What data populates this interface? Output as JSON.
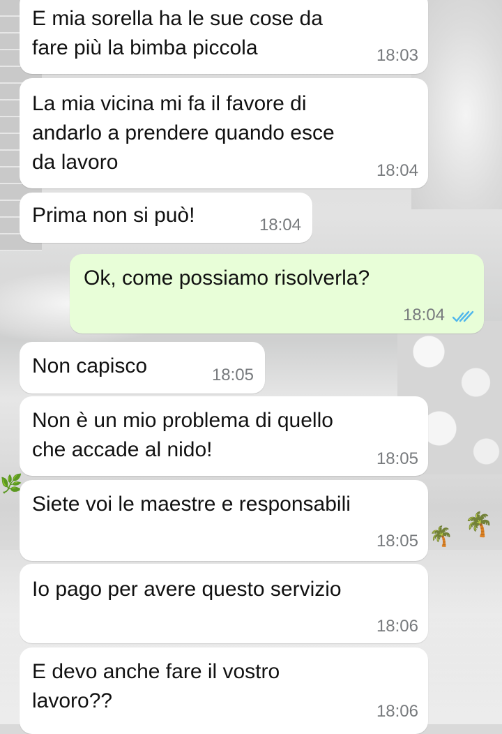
{
  "messages": [
    {
      "direction": "incoming",
      "text": "E mia sorella ha le sue cose da\nfare più la bimba piccola",
      "time": "18:03"
    },
    {
      "direction": "incoming",
      "text": "La mia vicina mi fa il favore di\nandarlo a prendere quando esce\nda lavoro",
      "time": "18:04"
    },
    {
      "direction": "incoming",
      "text": "Prima non si può!",
      "time": "18:04"
    },
    {
      "direction": "outgoing",
      "text": "Ok, come possiamo risolverla?",
      "time": "18:04",
      "status": "read"
    },
    {
      "direction": "incoming",
      "text": "Non capisco",
      "time": "18:05"
    },
    {
      "direction": "incoming",
      "text": "Non è un mio problema di quello\nche accade al nido!",
      "time": "18:05"
    },
    {
      "direction": "incoming",
      "text": "Siete voi le maestre e responsabili",
      "time": "18:05"
    },
    {
      "direction": "incoming",
      "text": "Io pago per avere questo servizio",
      "time": "18:06"
    },
    {
      "direction": "incoming",
      "text": "E devo anche fare il vostro\nlavoro??",
      "time": "18:06"
    }
  ],
  "colors": {
    "incoming_bubble": "#ffffff",
    "outgoing_bubble": "#e8fed8",
    "read_ticks": "#4fb6ec",
    "timestamp": "#777a7d"
  },
  "icons": {
    "read_receipt": "double-check-icon"
  }
}
